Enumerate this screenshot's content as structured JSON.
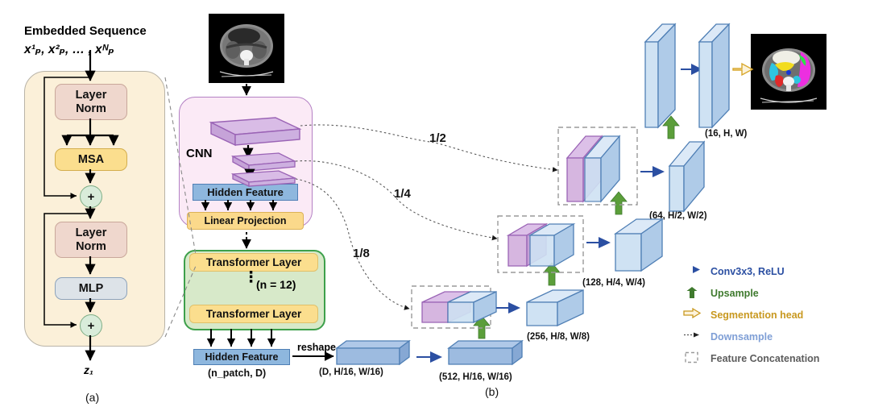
{
  "figure": {
    "caption_a": "(a)",
    "caption_b": "(b)"
  },
  "input": {
    "title_line1": "Embedded Sequence",
    "title_line2": "x¹ₚ, x²ₚ, … , xᴺₚ",
    "output_token": "z₁"
  },
  "transformer_block": {
    "layer_norm_1": "Layer\nNorm",
    "layer_norm_1_l1": "Layer",
    "layer_norm_1_l2": "Norm",
    "msa": "MSA",
    "layer_norm_2_l1": "Layer",
    "layer_norm_2_l2": "Norm",
    "mlp": "MLP",
    "add_symbol": "+"
  },
  "cnn": {
    "label": "CNN",
    "hidden_feature": "Hidden Feature",
    "linear_projection": "Linear Projection"
  },
  "transformer_stack": {
    "layer_top": "Transformer Layer",
    "layer_bottom": "Transformer Layer",
    "count": "(n = 12)",
    "dots": "⋮"
  },
  "encoder_output": {
    "hidden_feature": "Hidden Feature",
    "shape": "(n_patch, D)",
    "reshape_label": "reshape",
    "reshaped_shape": "(D, H/16, W/16)"
  },
  "skip_fractions": {
    "half": "1/2",
    "quarter": "1/4",
    "eighth": "1/8"
  },
  "decoder_shapes": {
    "bottleneck": "(512, H/16, W/16)",
    "stage_8": "(256, H/8, W/8)",
    "stage_4": "(128, H/4, W/4)",
    "stage_2": "(64, H/2, W/2)",
    "stage_1": "(16, H, W)"
  },
  "legend": {
    "items": [
      {
        "label": "Conv3x3, ReLU",
        "color": "#2b4fa2",
        "icon": "solid-arrow-right-icon"
      },
      {
        "label": "Upsample",
        "color": "#3f7a2e",
        "icon": "solid-arrow-up-icon"
      },
      {
        "label": "Segmentation head",
        "color": "#c8981f",
        "icon": "outline-arrow-right-icon"
      },
      {
        "label": "Downsample",
        "color": "#7f9fd6",
        "icon": "dotted-arrow-right-icon"
      },
      {
        "label": "Feature Concatenation",
        "color": "#5c5c5c",
        "icon": "dashed-box-icon"
      }
    ]
  },
  "colors": {
    "panel_a_bg": "#FBF0D9",
    "layer_norm": "#EFD7CD",
    "msa": "#FBDE8E",
    "mlp": "#DDE3E8",
    "add_circle": "#D9ECDA",
    "cnn_panel": "#FBEAF6",
    "cnn_border": "#b481c4",
    "transformer_panel": "#D7E9C9",
    "transformer_border": "#3da04b",
    "hidden_feature": "#8EB7DE",
    "feature_purple": "#D6B6E0",
    "feature_blue_light": "#CFE2F3",
    "feature_blue_mid": "#9FC0E2",
    "conv_arrow": "#2b4fa2",
    "upsample_arrow": "#5b9e3a",
    "seg_head_arrow": "#e8b93e"
  }
}
